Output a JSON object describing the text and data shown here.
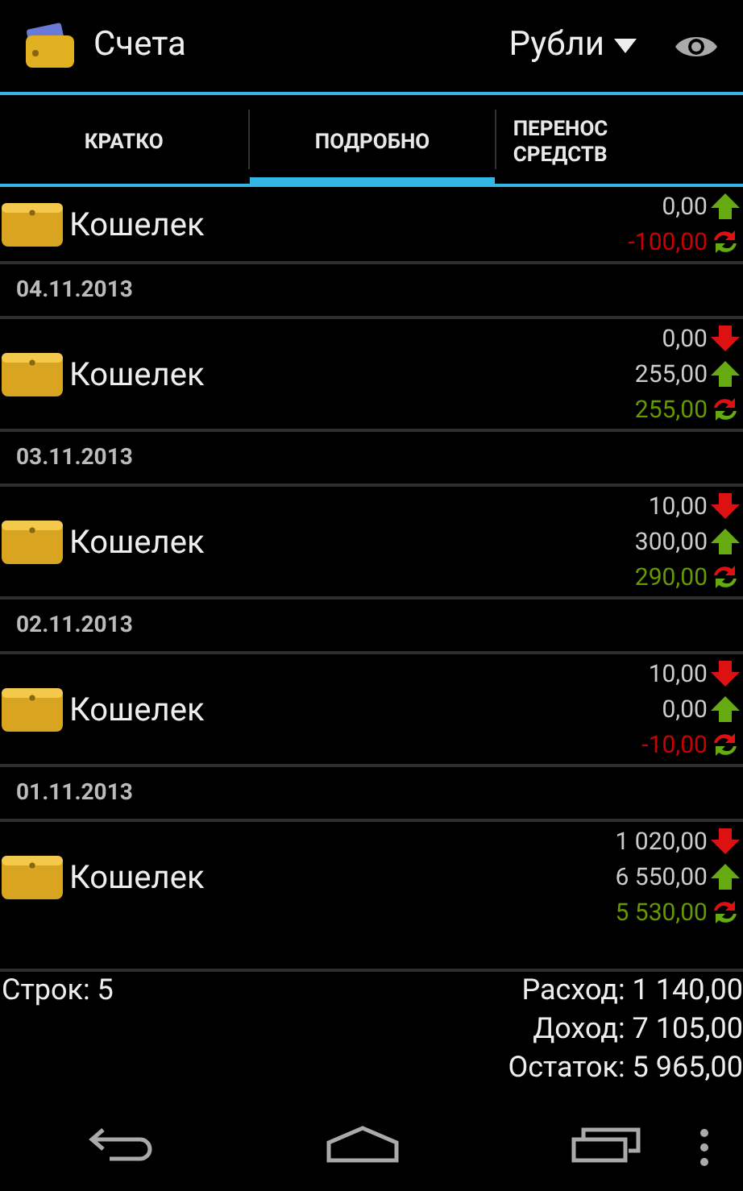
{
  "action_bar": {
    "title": "Счета",
    "currency": "Рубли"
  },
  "tabs": [
    {
      "label": "КРАТКО",
      "selected": false
    },
    {
      "label": "ПОДРОБНО",
      "selected": true
    },
    {
      "label": "ПЕРЕНОС СРЕДСТВ",
      "selected": false
    }
  ],
  "sections": [
    {
      "entries": [
        {
          "name": "Кошелек",
          "amounts": [
            {
              "kind": "income",
              "value": "0,00"
            },
            {
              "kind": "balance",
              "value": "-100,00",
              "color": "#cc0000"
            }
          ]
        }
      ]
    },
    {
      "date": "04.11.2013",
      "entries": [
        {
          "name": "Кошелек",
          "amounts": [
            {
              "kind": "expense",
              "value": "0,00"
            },
            {
              "kind": "income",
              "value": "255,00"
            },
            {
              "kind": "balance",
              "value": "255,00",
              "color": "#669900"
            }
          ]
        }
      ]
    },
    {
      "date": "03.11.2013",
      "entries": [
        {
          "name": "Кошелек",
          "amounts": [
            {
              "kind": "expense",
              "value": "10,00"
            },
            {
              "kind": "income",
              "value": "300,00"
            },
            {
              "kind": "balance",
              "value": "290,00",
              "color": "#669900"
            }
          ]
        }
      ]
    },
    {
      "date": "02.11.2013",
      "entries": [
        {
          "name": "Кошелек",
          "amounts": [
            {
              "kind": "expense",
              "value": "10,00"
            },
            {
              "kind": "income",
              "value": "0,00"
            },
            {
              "kind": "balance",
              "value": "-10,00",
              "color": "#cc0000"
            }
          ]
        }
      ]
    },
    {
      "date": "01.11.2013",
      "entries": [
        {
          "name": "Кошелек",
          "amounts": [
            {
              "kind": "expense",
              "value": "1 020,00"
            },
            {
              "kind": "income",
              "value": "6 550,00"
            },
            {
              "kind": "balance",
              "value": "5 530,00",
              "color": "#669900"
            }
          ]
        }
      ]
    }
  ],
  "footer": {
    "rows": "Строк: 5",
    "totals": [
      "Расход: 1 140,00",
      "Доход: 7 105,00",
      "Остаток: 5 965,00"
    ]
  }
}
